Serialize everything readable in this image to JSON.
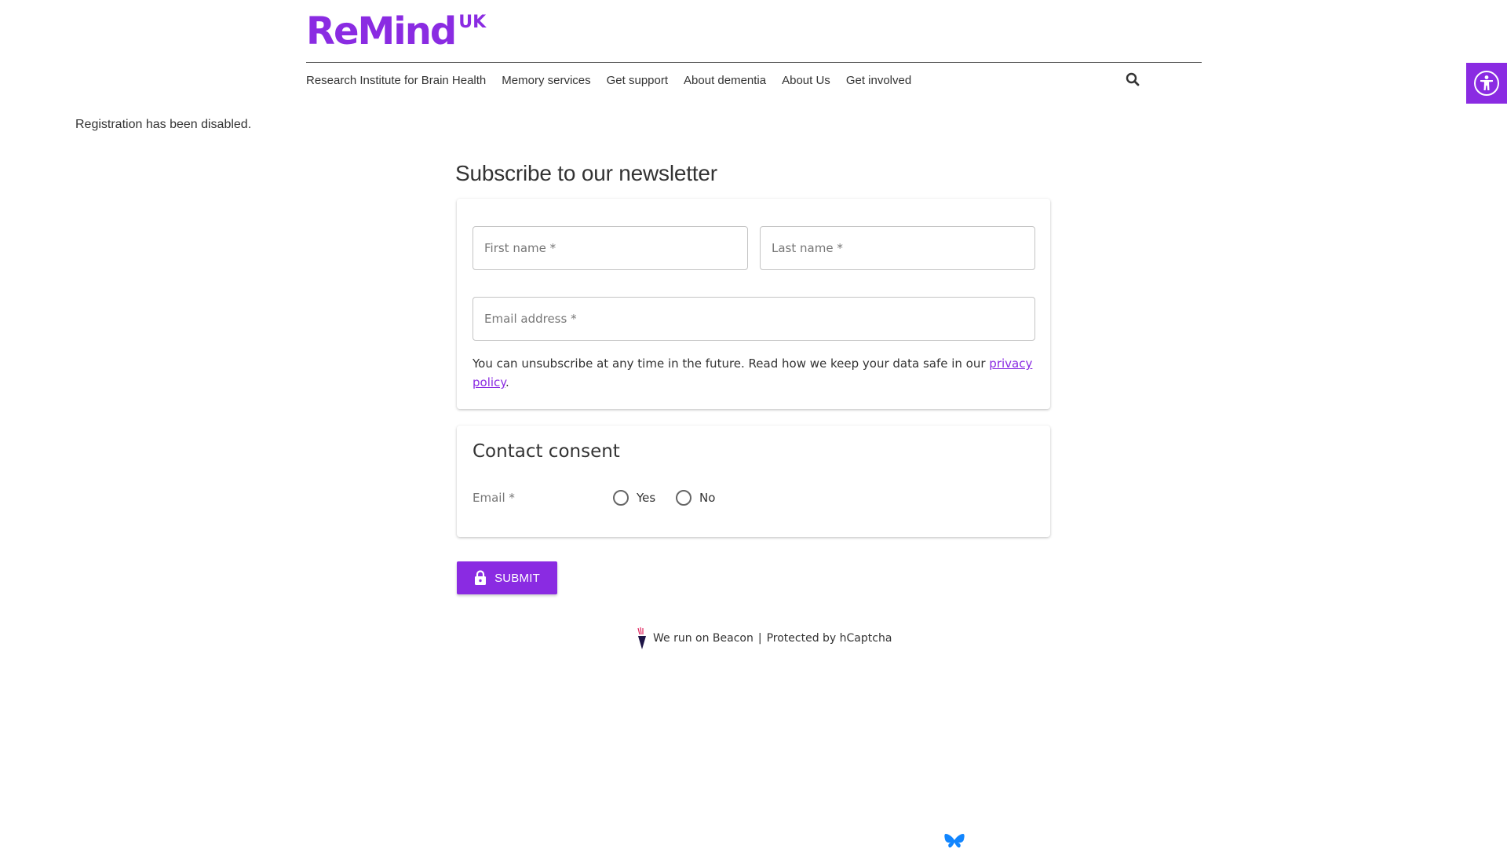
{
  "header": {
    "logo_text": "ReMind",
    "logo_sup": "UK",
    "nav": [
      "Research Institute for Brain Health",
      "Memory services",
      "Get support",
      "About dementia",
      "About Us",
      "Get involved"
    ]
  },
  "notice": "Registration has been disabled.",
  "form": {
    "title": "Subscribe to our newsletter",
    "first_name_placeholder": "First name *",
    "last_name_placeholder": "Last name *",
    "email_placeholder": "Email address *",
    "note_text": "You can unsubscribe at any time in the future. Read how we keep your data safe in our ",
    "note_link": "privacy policy",
    "note_end": ".",
    "consent": {
      "title": "Contact consent",
      "label": "Email *",
      "options": [
        "Yes",
        "No"
      ]
    },
    "submit_label": "SUBMIT"
  },
  "footer": {
    "beacon_text": "We run on Beacon",
    "separator": "|",
    "captcha_text": "Protected by hCaptcha"
  },
  "colors": {
    "brand": "#8a2be2",
    "text": "#333333",
    "border": "#c4c4c4"
  }
}
